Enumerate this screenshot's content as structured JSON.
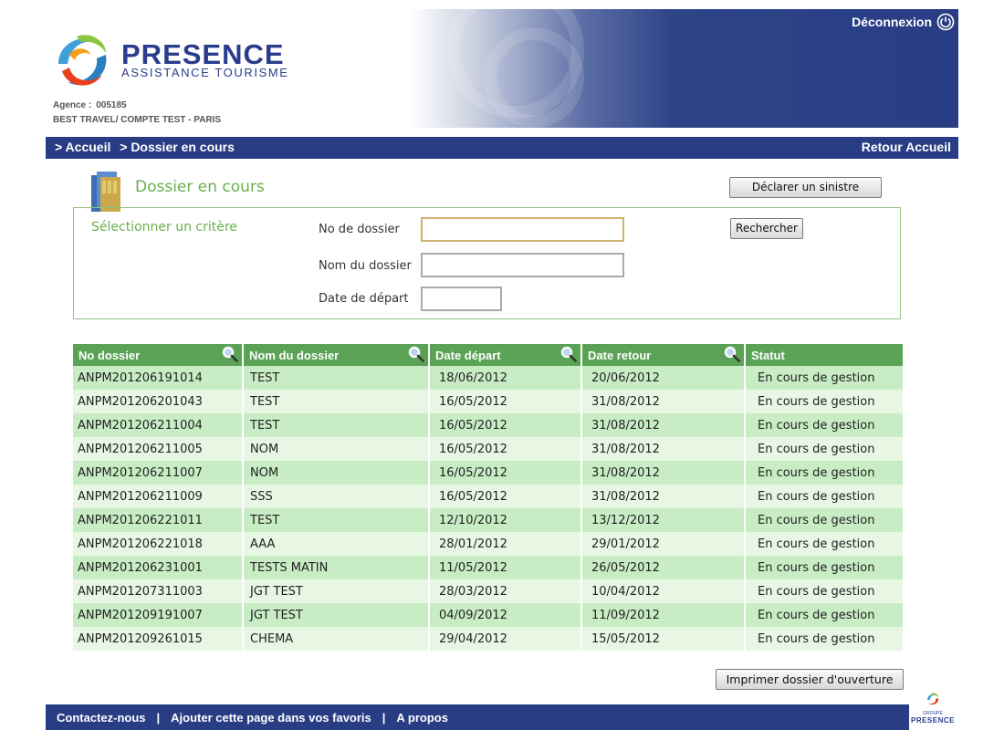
{
  "header": {
    "brand_name": "PRESENCE",
    "brand_sub": "ASSISTANCE TOURISME",
    "agency_label": "Agence :",
    "agency_number": "005185",
    "agency_name": "BEST TRAVEL/ COMPTE TEST - PARIS",
    "logout_label": "Déconnexion",
    "logout_icon": "power-icon"
  },
  "nav": {
    "breadcrumb": [
      "> Accueil",
      "> Dossier en cours"
    ],
    "back_home": "Retour Accueil"
  },
  "page": {
    "title": "Dossier en cours",
    "title_icon": "folder-icon",
    "declare_button": "Déclarer un sinistre"
  },
  "criteria": {
    "title": "Sélectionner un critère",
    "fields": [
      {
        "label": "No de dossier",
        "value": ""
      },
      {
        "label": "Nom du dossier",
        "value": ""
      },
      {
        "label": "Date de départ",
        "value": ""
      }
    ],
    "search_button": "Rechercher"
  },
  "table": {
    "columns": [
      "No dossier",
      "Nom du dossier",
      "Date départ",
      "Date retour",
      "Statut"
    ],
    "sort_icon": "zoom-icon",
    "rows": [
      {
        "no": "ANPM201206191014",
        "nom": "TEST",
        "depart": "18/06/2012",
        "retour": "20/06/2012",
        "statut": "En cours de gestion"
      },
      {
        "no": "ANPM201206201043",
        "nom": "TEST",
        "depart": "16/05/2012",
        "retour": "31/08/2012",
        "statut": "En cours de gestion"
      },
      {
        "no": "ANPM201206211004",
        "nom": "TEST",
        "depart": "16/05/2012",
        "retour": "31/08/2012",
        "statut": "En cours de gestion"
      },
      {
        "no": "ANPM201206211005",
        "nom": "NOM",
        "depart": "16/05/2012",
        "retour": "31/08/2012",
        "statut": "En cours de gestion"
      },
      {
        "no": "ANPM201206211007",
        "nom": "NOM",
        "depart": "16/05/2012",
        "retour": "31/08/2012",
        "statut": "En cours de gestion"
      },
      {
        "no": "ANPM201206211009",
        "nom": "SSS",
        "depart": "16/05/2012",
        "retour": "31/08/2012",
        "statut": "En cours de gestion"
      },
      {
        "no": "ANPM201206221011",
        "nom": "TEST",
        "depart": "12/10/2012",
        "retour": "13/12/2012",
        "statut": "En cours de gestion"
      },
      {
        "no": "ANPM201206221018",
        "nom": "AAA",
        "depart": "28/01/2012",
        "retour": "29/01/2012",
        "statut": "En cours de gestion"
      },
      {
        "no": "ANPM201206231001",
        "nom": "TESTS MATIN",
        "depart": "11/05/2012",
        "retour": "26/05/2012",
        "statut": "En cours de gestion"
      },
      {
        "no": "ANPM201207311003",
        "nom": "JGT TEST",
        "depart": "28/03/2012",
        "retour": "10/04/2012",
        "statut": "En cours de gestion"
      },
      {
        "no": "ANPM201209191007",
        "nom": "JGT TEST",
        "depart": "04/09/2012",
        "retour": "11/09/2012",
        "statut": "En cours de gestion"
      },
      {
        "no": "ANPM201209261015",
        "nom": "CHEMA",
        "depart": "29/04/2012",
        "retour": "15/05/2012",
        "statut": "En cours de gestion"
      }
    ]
  },
  "print_button": "Imprimer dossier d'ouverture",
  "footer": {
    "links": [
      "Contactez-nous",
      "Ajouter cette page dans vos favoris",
      "A propos"
    ],
    "separator": "|",
    "group_label": "GROUPE",
    "group_name": "PRESENCE"
  },
  "colors": {
    "navy": "#283d84",
    "green_header": "#5aa255",
    "row_dark": "#c8edc4",
    "row_light": "#e7f7e4",
    "title_green": "#6ab04c"
  }
}
